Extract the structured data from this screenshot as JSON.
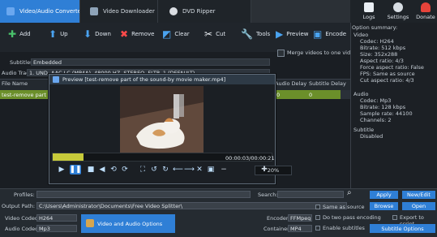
{
  "tabs": [
    {
      "label": "Video/Audio Converter"
    },
    {
      "label": "Video Downloader"
    },
    {
      "label": "DVD Ripper"
    }
  ],
  "top_actions": [
    {
      "label": "Logs"
    },
    {
      "label": "Settings"
    },
    {
      "label": "Donate"
    }
  ],
  "toolbar": {
    "add": "Add",
    "up": "Up",
    "down": "Down",
    "remove": "Remove",
    "clear": "Clear",
    "cut": "Cut",
    "tools": "Tools",
    "preview": "Preview",
    "encode": "Encode",
    "merge": "Merge videos to one video"
  },
  "fields": {
    "subtitles_label": "Subtitles:",
    "subtitles_value": "Embedded",
    "audio_track_label": "Audio Track:",
    "audio_track_value": "1. UND, AAC LC (MP4A), 48000 HZ, STEREO, FLTP, 1 (DEFAULT)"
  },
  "grid": {
    "col_file": "File Name",
    "col_audio_delay": "Audio Delay",
    "col_subtitle_delay": "Subtitle Delay",
    "row_file": "test-remove part of th"
  },
  "summary": {
    "title": "Option summary:",
    "video_h": "Video",
    "video_items": [
      "Codec: H264",
      "Bitrate: 512 kbps",
      "Size: 352x288",
      "Aspect ratio: 4/3",
      "Force aspect ratio: False",
      "FPS: Same as source",
      "Cut aspect ratio: 4/3"
    ],
    "audio_h": "Audio",
    "audio_items": [
      "Codec: Mp3",
      "Bitrate: 128 kbps",
      "Sample rate: 44100",
      "Channels: 2"
    ],
    "subtitle_h": "Subtitle",
    "subtitle_items": [
      "Disabled"
    ]
  },
  "preview": {
    "title": "Preview [test-remove part of the sound-by movie maker.mp4]",
    "time": "00:00:03/00:00:21",
    "progress": 0.14,
    "zoom": "20%"
  },
  "bottom": {
    "profiles_label": "Profiles:",
    "search_label": "Search:",
    "output_path_label": "Output Path:",
    "output_path_value": "C:\\Users\\Administrator\\Documents\\Free Video Splitter\\",
    "video_codec_label": "Video Codec:",
    "video_codec_value": "H264",
    "audio_codec_label": "Audio Codec:",
    "audio_codec_value": "Mp3",
    "video_audio_options": "Video and Audio Options",
    "encoder_label": "Encoder:",
    "encoder_value": "FFMpeg",
    "container_label": "Container:",
    "container_value": "MP4",
    "same_as_source": "Same as source",
    "two_pass": "Do two pass encoding",
    "enable_subtitles": "Enable subtitles",
    "apply": "Apply",
    "new_edit": "New/Edit",
    "browse": "Browse",
    "open": "Open",
    "export_script": "Export to script",
    "subtitle_options": "Subtitle Options"
  },
  "colors": {
    "accent": "#2f7fd6",
    "row_selected": "#6b8f2a",
    "progress": "#c7ca3a"
  }
}
